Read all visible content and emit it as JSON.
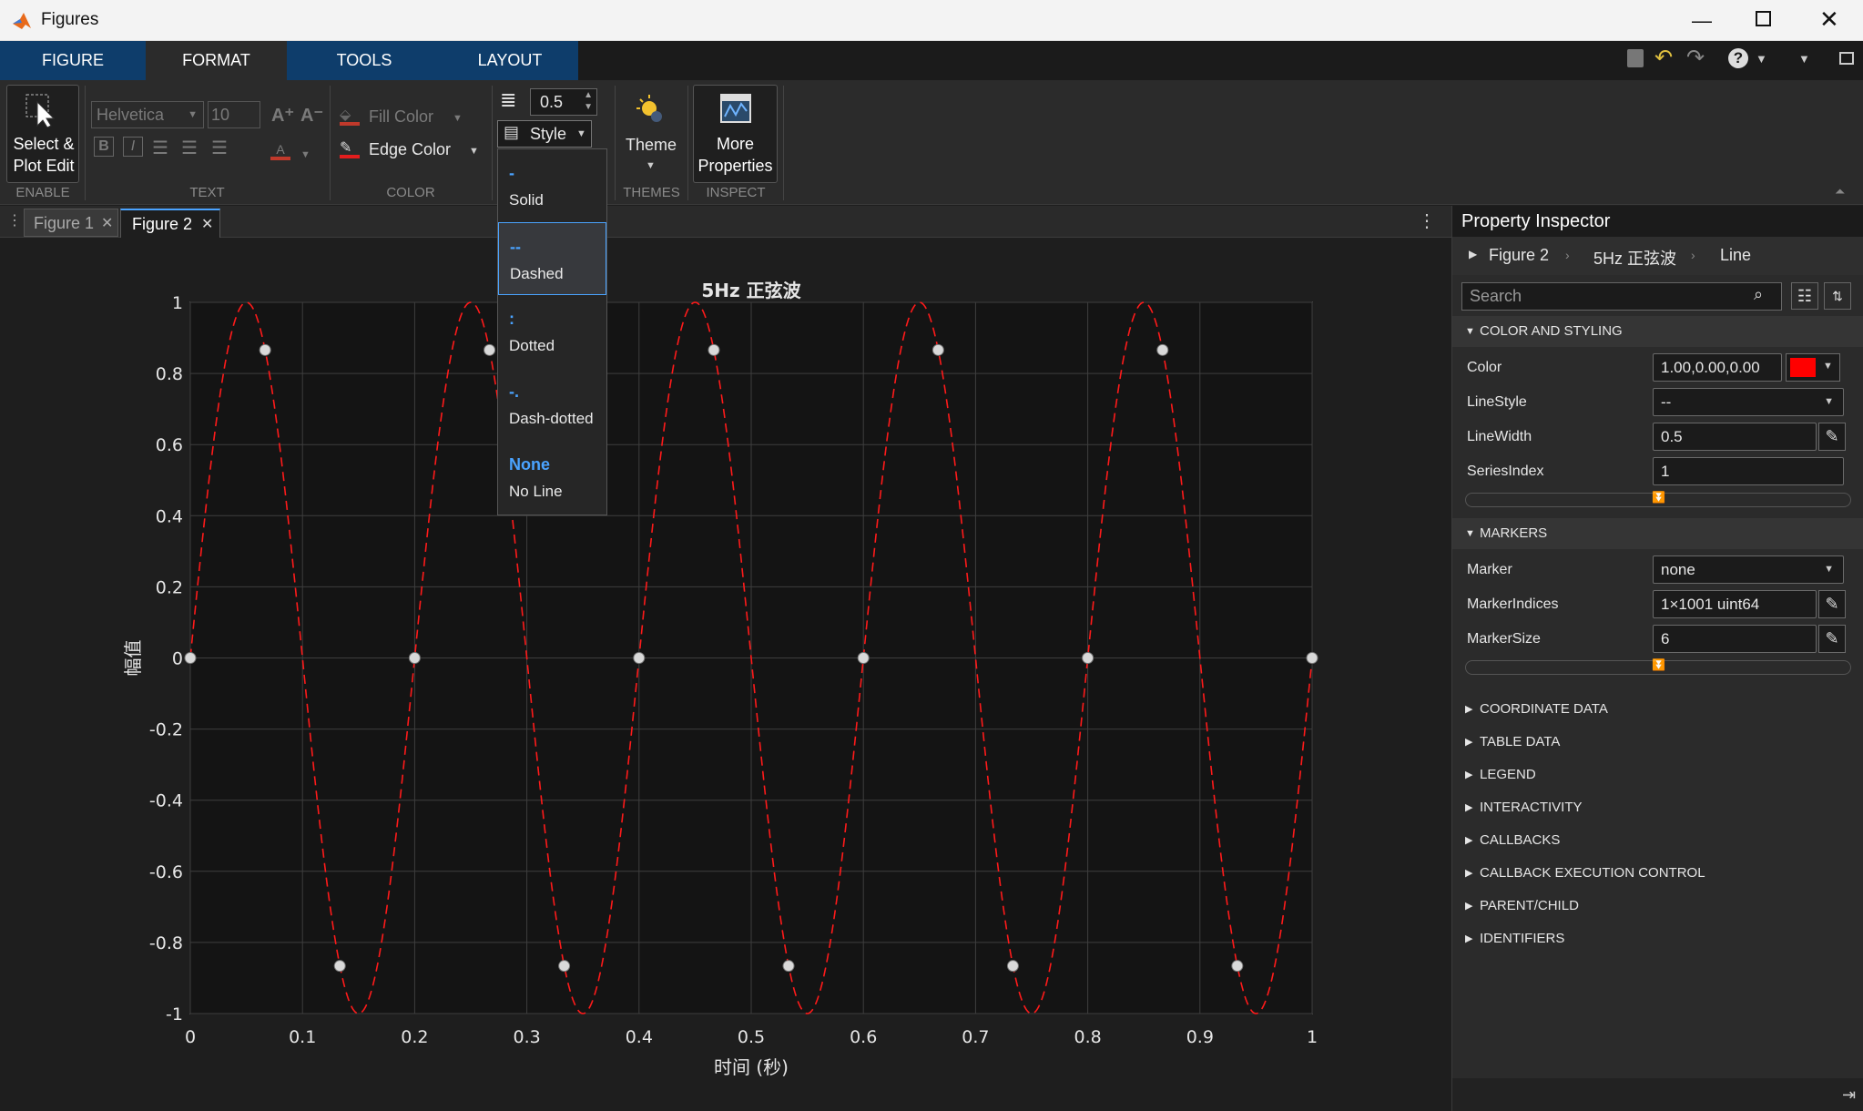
{
  "window": {
    "title": "Figures"
  },
  "menu": {
    "tabs": [
      "FIGURE",
      "FORMAT",
      "TOOLS",
      "LAYOUT"
    ],
    "active": "FORMAT"
  },
  "ribbon": {
    "enable": {
      "button_label_1": "Select &",
      "button_label_2": "Plot Edit",
      "section": "ENABLE"
    },
    "text": {
      "font": "Helvetica",
      "size": "10",
      "section": "TEXT"
    },
    "color": {
      "fill": "Fill Color",
      "edge": "Edge Color",
      "section": "COLOR"
    },
    "line": {
      "width": "0.5",
      "style_label": "Style"
    },
    "themes": {
      "label": "Theme",
      "section": "THEMES"
    },
    "inspect": {
      "label_1": "More",
      "label_2": "Properties",
      "section": "INSPECT"
    }
  },
  "style_dropdown": [
    {
      "symbol": "-",
      "label": "Solid"
    },
    {
      "symbol": "--",
      "label": "Dashed",
      "selected": true
    },
    {
      "symbol": ":",
      "label": "Dotted"
    },
    {
      "symbol": "-.",
      "label": "Dash-dotted"
    },
    {
      "symbol": "None",
      "label": "No Line"
    }
  ],
  "doc_tabs": [
    {
      "label": "Figure 1"
    },
    {
      "label": "Figure 2",
      "active": true
    }
  ],
  "chart_data": {
    "type": "line",
    "title": "5Hz 正弦波",
    "xlabel": "时间 (秒)",
    "ylabel": "幅值",
    "xlim": [
      0,
      1
    ],
    "ylim": [
      -1,
      1
    ],
    "x_ticks": [
      "0",
      "0.1",
      "0.2",
      "0.3",
      "0.4",
      "0.5",
      "0.6",
      "0.7",
      "0.8",
      "0.9",
      "1"
    ],
    "y_ticks": [
      "1",
      "0.8",
      "0.6",
      "0.4",
      "0.2",
      "0",
      "-0.2",
      "-0.4",
      "-0.6",
      "-0.8",
      "-1"
    ],
    "grid": true,
    "series": [
      {
        "function": "sin(2*pi*5*t)",
        "color": "#ff0000",
        "line_style": "dashed",
        "points_sampled": [
          [
            0,
            0
          ],
          [
            0.05,
            1
          ],
          [
            0.1,
            0
          ],
          [
            0.15,
            -1
          ],
          [
            0.2,
            0
          ],
          [
            0.25,
            1
          ],
          [
            0.3,
            0
          ],
          [
            0.35,
            -1
          ],
          [
            0.4,
            0
          ],
          [
            0.45,
            1
          ],
          [
            0.5,
            0
          ],
          [
            0.55,
            -1
          ],
          [
            0.6,
            0
          ],
          [
            0.65,
            1
          ],
          [
            0.7,
            0
          ],
          [
            0.75,
            -1
          ],
          [
            0.8,
            0
          ],
          [
            0.85,
            1
          ],
          [
            0.9,
            0
          ],
          [
            0.95,
            -1
          ],
          [
            1,
            0
          ]
        ]
      }
    ],
    "highlight_points": [
      [
        0,
        0
      ],
      [
        0.0667,
        0.866
      ],
      [
        0.1333,
        -0.866
      ],
      [
        0.2,
        0
      ],
      [
        0.2667,
        0.866
      ],
      [
        0.3333,
        -0.866
      ],
      [
        0.4,
        0
      ],
      [
        0.4667,
        0.866
      ],
      [
        0.5333,
        -0.866
      ],
      [
        0.6,
        0
      ],
      [
        0.6667,
        0.866
      ],
      [
        0.7333,
        -0.866
      ],
      [
        0.8,
        0
      ],
      [
        0.8667,
        0.866
      ],
      [
        0.9333,
        -0.866
      ],
      [
        1,
        0
      ]
    ]
  },
  "inspector": {
    "title": "Property Inspector",
    "breadcrumb": [
      "Figure 2",
      "5Hz 正弦波",
      "Line"
    ],
    "search_placeholder": "Search",
    "sections_open": [
      {
        "title": "COLOR AND STYLING",
        "props": [
          {
            "label": "Color",
            "value": "1.00,0.00,0.00"
          },
          {
            "label": "LineStyle",
            "value": "--"
          },
          {
            "label": "LineWidth",
            "value": "0.5"
          },
          {
            "label": "SeriesIndex",
            "value": "1"
          }
        ]
      },
      {
        "title": "MARKERS",
        "props": [
          {
            "label": "Marker",
            "value": "none"
          },
          {
            "label": "MarkerIndices",
            "value": "1×1001 uint64"
          },
          {
            "label": "MarkerSize",
            "value": "6"
          }
        ]
      }
    ],
    "sections_closed": [
      "COORDINATE DATA",
      "TABLE DATA",
      "LEGEND",
      "INTERACTIVITY",
      "CALLBACKS",
      "CALLBACK EXECUTION CONTROL",
      "PARENT/CHILD",
      "IDENTIFIERS"
    ]
  }
}
